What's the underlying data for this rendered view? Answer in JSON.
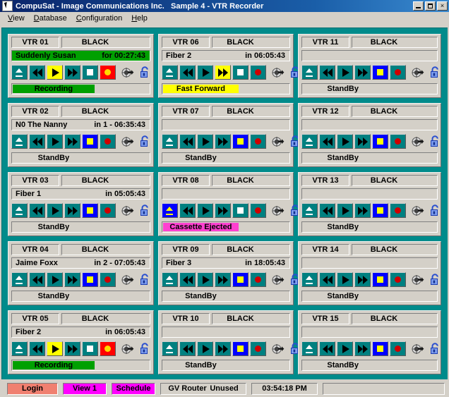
{
  "window": {
    "title": "CompuSat - Image Communications Inc.   Sample 4 - VTR Recorder",
    "minimize_label": "",
    "maximize_label": "",
    "close_label": "×"
  },
  "menu": {
    "items": [
      {
        "label": "View"
      },
      {
        "label": "Database"
      },
      {
        "label": "Configuration"
      },
      {
        "label": "Help"
      }
    ]
  },
  "vtrs": [
    {
      "name": "VTR 01",
      "source": "BLACK",
      "info_title": "Suddenly Susan",
      "info_time": "for 00:27:43",
      "info_highlight": "green",
      "buttons": {
        "eject": "normal",
        "rewind": "normal",
        "play": "yellow",
        "ff": "normal",
        "stop": "normal",
        "record": "red"
      },
      "status": "Recording",
      "status_color": "green"
    },
    {
      "name": "VTR 02",
      "source": "BLACK",
      "info_title": "N0 The Nanny",
      "info_time": "in 1 - 06:35:43",
      "info_highlight": "none",
      "buttons": {
        "eject": "normal",
        "rewind": "normal",
        "play": "normal",
        "ff": "normal",
        "stop": "blue",
        "record": "normal"
      },
      "status": "StandBy",
      "status_color": "plain"
    },
    {
      "name": "VTR 03",
      "source": "BLACK",
      "info_title": "Fiber 1",
      "info_time": "in 05:05:43",
      "info_highlight": "none",
      "buttons": {
        "eject": "normal",
        "rewind": "normal",
        "play": "normal",
        "ff": "normal",
        "stop": "blue",
        "record": "normal"
      },
      "status": "StandBy",
      "status_color": "plain"
    },
    {
      "name": "VTR 04",
      "source": "BLACK",
      "info_title": "Jaime Foxx",
      "info_time": "in 2 - 07:05:43",
      "info_highlight": "none",
      "buttons": {
        "eject": "normal",
        "rewind": "normal",
        "play": "normal",
        "ff": "normal",
        "stop": "blue",
        "record": "normal"
      },
      "status": "StandBy",
      "status_color": "plain"
    },
    {
      "name": "VTR 05",
      "source": "BLACK",
      "info_title": "Fiber 2",
      "info_time": "in 06:05:43",
      "info_highlight": "none",
      "buttons": {
        "eject": "normal",
        "rewind": "normal",
        "play": "yellow",
        "ff": "normal",
        "stop": "normal",
        "record": "red"
      },
      "status": "Recording",
      "status_color": "green"
    },
    {
      "name": "VTR 06",
      "source": "BLACK",
      "info_title": "Fiber 2",
      "info_time": "in 06:05:43",
      "info_highlight": "none",
      "buttons": {
        "eject": "normal",
        "rewind": "normal",
        "play": "normal",
        "ff": "yellow",
        "stop": "normal",
        "record": "normal"
      },
      "status": "Fast Forward",
      "status_color": "yellow"
    },
    {
      "name": "VTR 07",
      "source": "BLACK",
      "info_title": "",
      "info_time": "",
      "info_highlight": "none",
      "buttons": {
        "eject": "normal",
        "rewind": "normal",
        "play": "normal",
        "ff": "normal",
        "stop": "blue",
        "record": "normal"
      },
      "status": "StandBy",
      "status_color": "plain"
    },
    {
      "name": "VTR 08",
      "source": "BLACK",
      "info_title": "",
      "info_time": "",
      "info_highlight": "none",
      "buttons": {
        "eject": "blue",
        "rewind": "normal",
        "play": "normal",
        "ff": "normal",
        "stop": "normal",
        "record": "normal"
      },
      "status": "Cassette Ejected",
      "status_color": "magenta"
    },
    {
      "name": "VTR 09",
      "source": "BLACK",
      "info_title": "Fiber 3",
      "info_time": "in 18:05:43",
      "info_highlight": "none",
      "buttons": {
        "eject": "normal",
        "rewind": "normal",
        "play": "normal",
        "ff": "normal",
        "stop": "blue",
        "record": "normal"
      },
      "status": "StandBy",
      "status_color": "plain"
    },
    {
      "name": "VTR 10",
      "source": "BLACK",
      "info_title": "",
      "info_time": "",
      "info_highlight": "none",
      "buttons": {
        "eject": "normal",
        "rewind": "normal",
        "play": "normal",
        "ff": "normal",
        "stop": "blue",
        "record": "normal"
      },
      "status": "StandBy",
      "status_color": "plain"
    },
    {
      "name": "VTR 11",
      "source": "BLACK",
      "info_title": "",
      "info_time": "",
      "info_highlight": "none",
      "buttons": {
        "eject": "normal",
        "rewind": "normal",
        "play": "normal",
        "ff": "normal",
        "stop": "blue",
        "record": "normal"
      },
      "status": "StandBy",
      "status_color": "plain"
    },
    {
      "name": "VTR 12",
      "source": "BLACK",
      "info_title": "",
      "info_time": "",
      "info_highlight": "none",
      "buttons": {
        "eject": "normal",
        "rewind": "normal",
        "play": "normal",
        "ff": "normal",
        "stop": "blue",
        "record": "normal"
      },
      "status": "StandBy",
      "status_color": "plain"
    },
    {
      "name": "VTR 13",
      "source": "BLACK",
      "info_title": "",
      "info_time": "",
      "info_highlight": "none",
      "buttons": {
        "eject": "normal",
        "rewind": "normal",
        "play": "normal",
        "ff": "normal",
        "stop": "blue",
        "record": "normal"
      },
      "status": "StandBy",
      "status_color": "plain"
    },
    {
      "name": "VTR 14",
      "source": "BLACK",
      "info_title": "",
      "info_time": "",
      "info_highlight": "none",
      "buttons": {
        "eject": "normal",
        "rewind": "normal",
        "play": "normal",
        "ff": "normal",
        "stop": "blue",
        "record": "normal"
      },
      "status": "StandBy",
      "status_color": "plain"
    },
    {
      "name": "VTR 15",
      "source": "BLACK",
      "info_title": "",
      "info_time": "",
      "info_highlight": "none",
      "buttons": {
        "eject": "normal",
        "rewind": "normal",
        "play": "normal",
        "ff": "normal",
        "stop": "blue",
        "record": "normal"
      },
      "status": "StandBy",
      "status_color": "plain"
    }
  ],
  "statusbar": {
    "login": "Login",
    "view": "View 1",
    "schedule": "Schedule",
    "router_name": "GV Router",
    "router_state": "Unused",
    "time": "03:54:18 PM"
  },
  "colors": {
    "workspace_teal": "#008b8b",
    "button_teal": "#008080",
    "recording_green": "#00a000",
    "active_yellow": "#ffff00",
    "active_blue": "#0000ff",
    "record_red": "#ff0000",
    "ejected_magenta": "#ff40d0",
    "login_salmon": "#f08070",
    "view_magenta": "#ff00ff",
    "face_gray": "#d4d0c8"
  }
}
